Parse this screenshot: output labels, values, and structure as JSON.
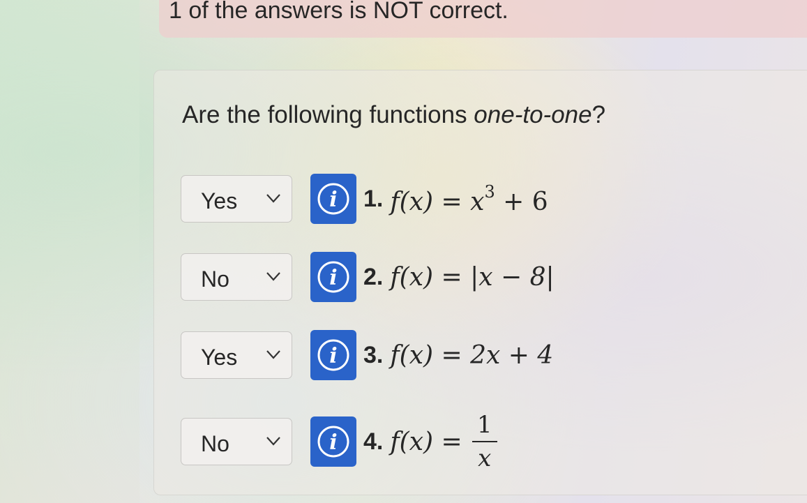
{
  "alert": {
    "message": "1 of the answers is NOT correct."
  },
  "question": {
    "prompt_prefix": "Are the following functions ",
    "prompt_emphasis": "one-to-one",
    "prompt_suffix": "?"
  },
  "items": [
    {
      "number": "1.",
      "answer": "Yes",
      "lhs": "f(x) = ",
      "rhs_base": "x",
      "rhs_exp": "3",
      "rhs_tail": " + 6"
    },
    {
      "number": "2.",
      "answer": "No",
      "expression": "f(x) = |x − 8|"
    },
    {
      "number": "3.",
      "answer": "Yes",
      "expression": "f(x) = 2x + 4"
    },
    {
      "number": "4.",
      "answer": "No",
      "lhs": "f(x) =",
      "frac_num": "1",
      "frac_den": "x"
    }
  ],
  "colors": {
    "info_button": "#2a63c9",
    "alert_background": "#eecdcd"
  },
  "icons": {
    "info": "info-icon",
    "dropdown": "chevron-down-icon"
  }
}
